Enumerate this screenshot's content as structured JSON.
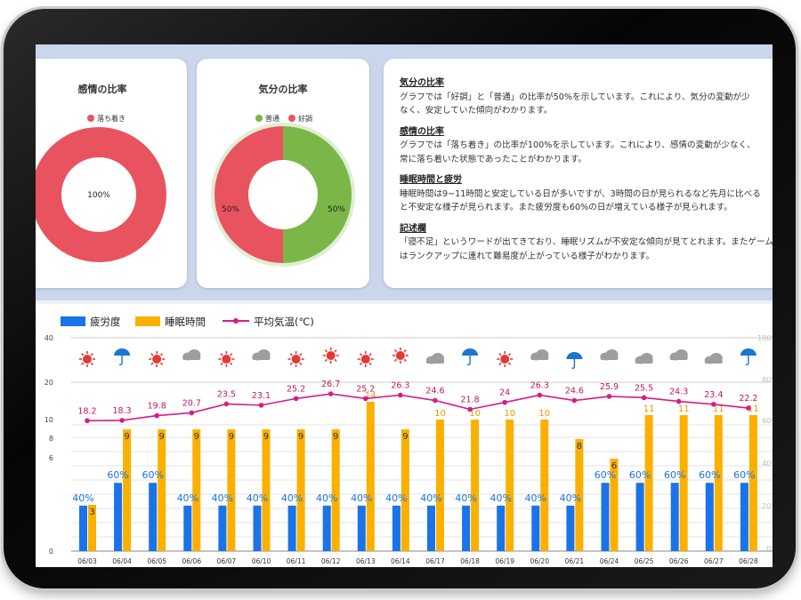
{
  "cards": {
    "emotion": {
      "title": "感情の比率",
      "legend": [
        {
          "label": "落ち着き",
          "color": "#e9535f"
        }
      ],
      "slice_label": "100%"
    },
    "mood": {
      "title": "気分の比率",
      "legend": [
        {
          "label": "普通",
          "color": "#7ab648"
        },
        {
          "label": "好調",
          "color": "#e9535f"
        }
      ],
      "left_label": "50%",
      "right_label": "50%"
    }
  },
  "summary": [
    {
      "heading": "気分の比率",
      "lines": [
        "グラフでは「好調」と「普通」の比率が50%を示しています。これにより、気分の変動が少",
        "なく、安定していた傾向がわかります。"
      ]
    },
    {
      "heading": "感情の比率",
      "lines": [
        "グラフでは「落ち着き」の比率が100%を示しています。これにより、感情の変動が少なく、",
        "常に落ち着いた状態であったことがわかります。"
      ]
    },
    {
      "heading": "睡眠時間と疲労",
      "lines": [
        "睡眠時間は9~11時間と安定している日が多いですが、3時間の日が見られるなど先月に比べる",
        "と不安定な様子が見られます。また疲労度も60%の日が増えている様子が見られます。"
      ]
    },
    {
      "heading": "記述欄",
      "lines": [
        "「寝不足」というワードが出てきており、睡眠リズムが不安定な傾向が見てとれます。またゲームに関して",
        "はランクアップに連れて難易度が上がっている様子がわかります。"
      ]
    }
  ],
  "chart_data": [
    {
      "type": "pie",
      "title": "感情の比率",
      "categories": [
        "落ち着き"
      ],
      "values": [
        100
      ],
      "colors": [
        "#e9535f"
      ]
    },
    {
      "type": "pie",
      "title": "気分の比率",
      "categories": [
        "普通",
        "好調"
      ],
      "values": [
        50,
        50
      ],
      "colors": [
        "#7ab648",
        "#e9535f"
      ]
    },
    {
      "type": "bar",
      "legend": {
        "position": "top-left",
        "items": [
          "疲労度",
          "睡眠時間",
          "平均気温(℃)"
        ]
      },
      "categories": [
        "06/03",
        "06/04",
        "06/05",
        "06/06",
        "06/07",
        "06/10",
        "06/11",
        "06/12",
        "06/13",
        "06/14",
        "06/17",
        "06/18",
        "06/19",
        "06/20",
        "06/21",
        "06/24",
        "06/25",
        "06/26",
        "06/27",
        "06/28"
      ],
      "series": [
        {
          "name": "疲労度",
          "color": "#1a73e8",
          "values": [
            40,
            60,
            60,
            40,
            40,
            40,
            40,
            40,
            40,
            40,
            40,
            40,
            40,
            40,
            40,
            60,
            60,
            60,
            60,
            60
          ],
          "labels": [
            "40%",
            "60%",
            "60%",
            "40%",
            "40%",
            "40%",
            "40%",
            "40%",
            "40%",
            "40%",
            "40%",
            "40%",
            "40%",
            "40%",
            "40%",
            "60%",
            "60%",
            "60%",
            "60%",
            "60%"
          ]
        },
        {
          "name": "睡眠時間",
          "color": "#fbb000",
          "values": [
            3,
            9,
            9,
            9,
            9,
            9,
            9,
            9,
            14,
            9,
            10,
            10,
            10,
            10,
            8,
            6,
            11,
            11,
            11,
            11
          ]
        },
        {
          "name": "平均気温(℃)",
          "type": "line",
          "color": "#d81b87",
          "values": [
            18.2,
            18.3,
            19.8,
            20.7,
            23.5,
            23.1,
            25.2,
            26.7,
            25.2,
            26.3,
            24.6,
            21.8,
            24,
            26.3,
            24.6,
            25.9,
            25.5,
            24.3,
            23.4,
            22.2
          ]
        }
      ],
      "weather": [
        "sun",
        "rain",
        "sun",
        "cloud",
        "sun",
        "cloud",
        "sun",
        "sun",
        "sun",
        "sun",
        "cloud",
        "rain",
        "sun",
        "cloud",
        "rain",
        "cloud",
        "cloud",
        "cloud",
        "cloud",
        "rain"
      ],
      "y_left_ticks": [
        "0",
        "6",
        "8",
        "10",
        "20",
        "40"
      ],
      "y_right_ticks": [
        "100%",
        "80%",
        "60%",
        "40%",
        "20%",
        "0%"
      ]
    }
  ]
}
